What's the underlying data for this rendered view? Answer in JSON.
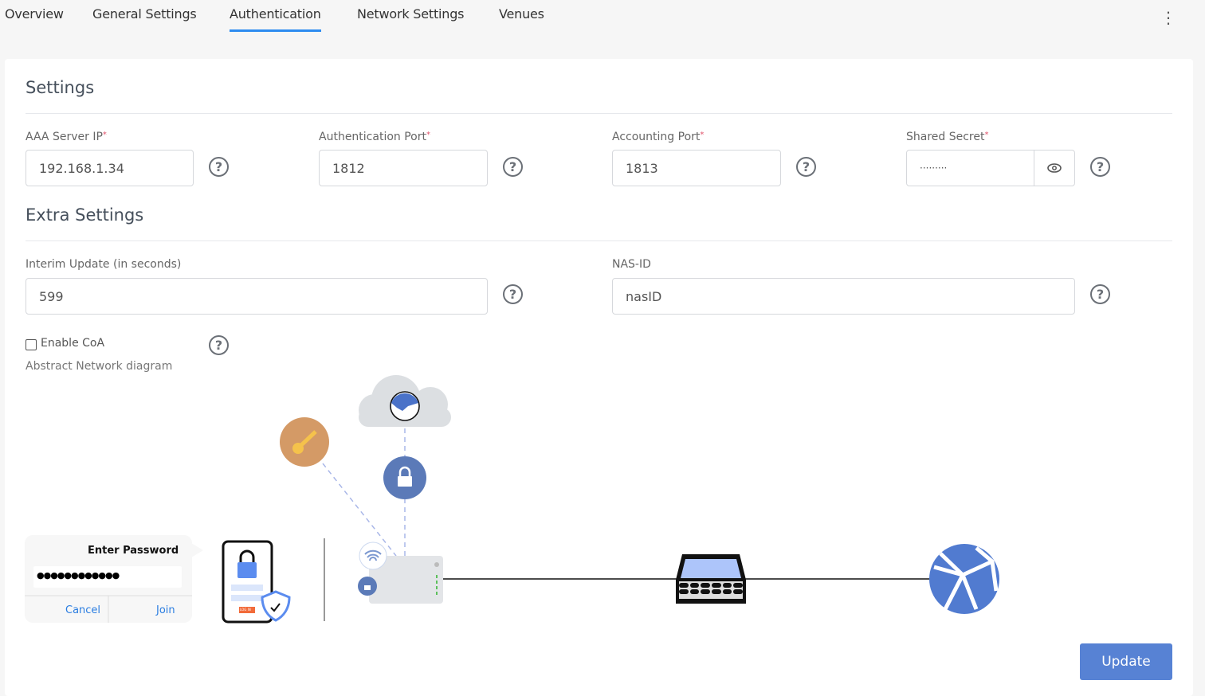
{
  "tabs": [
    {
      "label": "Overview"
    },
    {
      "label": "General Settings"
    },
    {
      "label": "Authentication",
      "active": true
    },
    {
      "label": "Network Settings"
    },
    {
      "label": "Venues"
    }
  ],
  "settings": {
    "title": "Settings",
    "aaa_label": "AAA Server IP",
    "aaa_value": "192.168.1.34",
    "auth_port_label": "Authentication Port",
    "auth_port_value": "1812",
    "acct_port_label": "Accounting Port",
    "acct_port_value": "1813",
    "secret_label": "Shared Secret",
    "secret_value": "·········",
    "required_mark": "*"
  },
  "extra": {
    "title": "Extra Settings",
    "interim_label": "Interim Update (in seconds)",
    "interim_value": "599",
    "nasid_label": "NAS-ID",
    "nasid_value": "nasID",
    "coa_label": "Enable CoA",
    "coa_checked": false,
    "diagram_label": "Abstract Network diagram"
  },
  "diagram": {
    "dialog_title": "Enter Password",
    "dialog_password": "●●●●●●●●●●●●",
    "cancel": "Cancel",
    "join": "Join",
    "login_text": "LOG IN",
    "colors": {
      "key": "#d49a66",
      "lock": "#5b7ab8",
      "globe": "#517bd0",
      "cloud": "#dcdfe2"
    }
  },
  "actions": {
    "update": "Update"
  },
  "icons": {
    "help": "?",
    "menu": "⋮"
  },
  "colors": {
    "accent": "#2d8cf0",
    "button": "#5782d4"
  }
}
